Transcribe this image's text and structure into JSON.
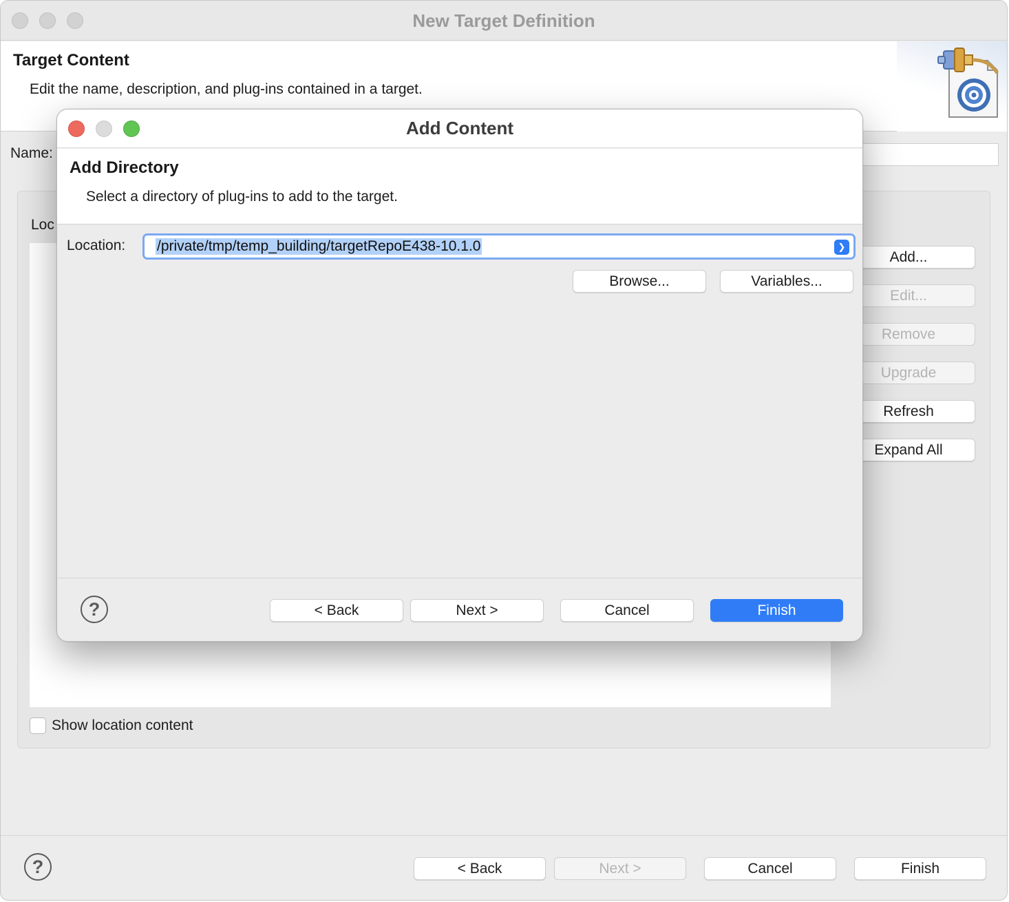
{
  "outer_window": {
    "title": "New Target Definition",
    "page_title": "Target Content",
    "page_description": "Edit the name, description, and plug-ins contained in a target.",
    "name_label": "Name:",
    "locations_label": "Loc",
    "side_buttons": {
      "add": "Add...",
      "edit": "Edit...",
      "remove": "Remove",
      "upgrade": "Upgrade",
      "refresh": "Refresh",
      "expand_all": "Expand All"
    },
    "show_location_content": "Show location content",
    "footer": {
      "help": "?",
      "back": "< Back",
      "next": "Next >",
      "cancel": "Cancel",
      "finish": "Finish"
    }
  },
  "dialog": {
    "title": "Add Content",
    "header_title": "Add Directory",
    "header_description": "Select a directory of plug-ins to add to the target.",
    "location_label": "Location:",
    "location_value": "/private/tmp/temp_building/targetRepoE438-10.1.0",
    "browse": "Browse...",
    "variables": "Variables...",
    "footer": {
      "help": "?",
      "back": "< Back",
      "next": "Next >",
      "cancel": "Cancel",
      "finish": "Finish"
    }
  },
  "colors": {
    "primary_button": "#2f7cf6",
    "selection_highlight": "#b2d1f8",
    "close_button": "#ed6a5e",
    "zoom_button": "#61c554"
  }
}
